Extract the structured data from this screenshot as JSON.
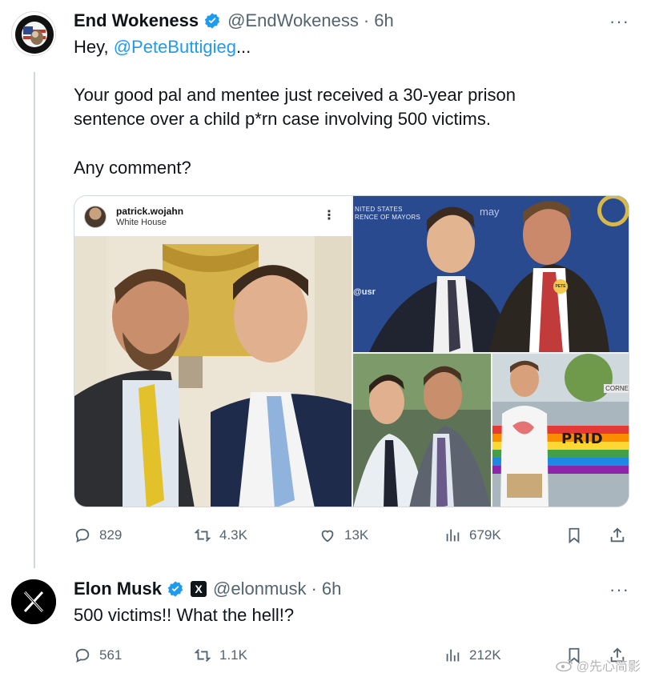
{
  "tweet1": {
    "name": "End Wokeness",
    "handle": "@EndWokeness",
    "time": "6h",
    "dot": "·",
    "more": "···",
    "line1_prefix": "Hey, ",
    "line1_mention": "@PeteButtigieg",
    "line1_suffix": "...",
    "line2": "Your good pal and mentee just received a 30-year prison",
    "line3": "sentence over a child p*rn case involving 500 victims.",
    "line4": "Any comment?",
    "avatar_label": "I SUPPORT THE FORMER THING",
    "media": {
      "insta_user": "patrick.wojahn",
      "insta_location": "White House",
      "insta_more": "⋮",
      "usc_line1": "NITED STATES",
      "usc_line2": "RENCE OF MAYORS",
      "may": "may",
      "usr": "@usr",
      "pete_button": "PETE",
      "corner": "CORNE",
      "pride": "PRID"
    },
    "stats": {
      "replies": "829",
      "reposts": "4.3K",
      "likes": "13K",
      "views": "679K"
    }
  },
  "tweet2": {
    "name": "Elon Musk",
    "handle": "@elonmusk",
    "time": "6h",
    "dot": "·",
    "more": "···",
    "badge": "X",
    "text": "500 victims!! What the hell!?",
    "stats": {
      "replies": "561",
      "reposts": "1.1K",
      "views": "212K"
    }
  },
  "watermark": "@先心简影",
  "colors": {
    "accent": "#1d9bf0",
    "muted": "#536471",
    "text": "#0f1419",
    "thread_line": "#cfd9de"
  }
}
